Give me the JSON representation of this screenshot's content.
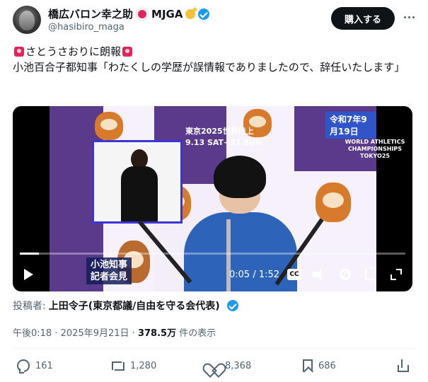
{
  "author": {
    "display_name": "橋広バロン幸之助",
    "display_suffix": "MJGA",
    "handle": "@hasibiro_maga"
  },
  "header": {
    "buy_label": "購入する"
  },
  "tweet": {
    "line1": "さとうさおりに朗報",
    "line2": "小池百合子都知事「わたくしの学歴が誤情報でありましたので、辞任いたします」"
  },
  "video": {
    "event_title": "東京2025世界陸上",
    "event_dates": "9.13 SAT−21 SUN",
    "date_badge": "令和7年9月19日",
    "wac_line1": "WORLD ATHLETICS",
    "wac_line2": "CHAMPIONSHIPS",
    "wac_line3": "TOKYO25",
    "caption_line1": "小池知事",
    "caption_line2": "記者会見",
    "time": "0:05 / 1:52",
    "cc_label": "CC",
    "progress_fraction": 0.05
  },
  "poster": {
    "label": "投稿者:",
    "name": "上田令子(東京都議/自由を守る会代表)"
  },
  "meta": {
    "time": "午後0:18",
    "sep1": "·",
    "date": "2025年9月21日",
    "sep2": "·",
    "views": "378.5万",
    "views_suffix": "件の表示"
  },
  "actions": {
    "replies": "161",
    "reposts": "1,280",
    "likes": "8,368",
    "bookmarks": "686"
  },
  "colors": {
    "accent": "#1d9bf0",
    "text_primary": "#0f1419",
    "text_secondary": "#536471"
  }
}
